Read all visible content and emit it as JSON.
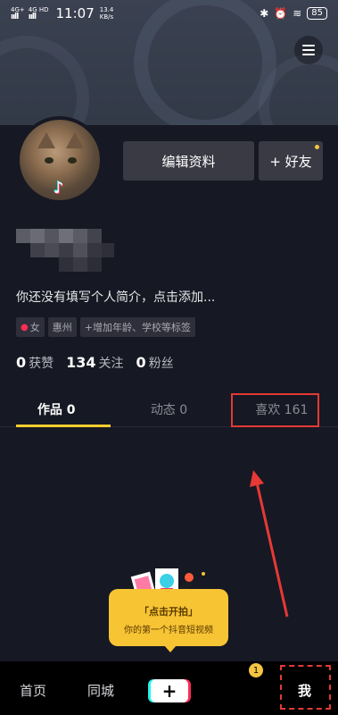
{
  "status_bar": {
    "signal1": "4G+",
    "signal2": "4G HD",
    "time": "11:07",
    "speed_value": "13.4",
    "speed_unit": "KB/s",
    "battery": "85"
  },
  "profile": {
    "edit_label": "编辑资料",
    "add_friend_label": "+ 好友",
    "bio": "你还没有填写个人简介，点击添加...",
    "tags": [
      {
        "label": "女",
        "icon": "female-icon"
      },
      {
        "label": "惠州"
      },
      {
        "label": "+增加年龄、学校等标签"
      }
    ],
    "stats": [
      {
        "value": "0",
        "label": "获赞"
      },
      {
        "value": "134",
        "label": "关注"
      },
      {
        "value": "0",
        "label": "粉丝"
      }
    ]
  },
  "tabs": [
    {
      "label": "作品 0",
      "active": true
    },
    {
      "label": "动态 0",
      "active": false
    },
    {
      "label": "喜欢 161",
      "active": false
    }
  ],
  "promo": {
    "title": "「点击开拍」",
    "subtitle": "你的第一个抖音短视频"
  },
  "bottom_nav": {
    "home": "首页",
    "nearby": "同城",
    "plus": "+",
    "badge": "1",
    "me": "我"
  },
  "colors": {
    "background": "#161823",
    "accent_yellow": "#facd2c",
    "highlight_red": "#e53935"
  }
}
